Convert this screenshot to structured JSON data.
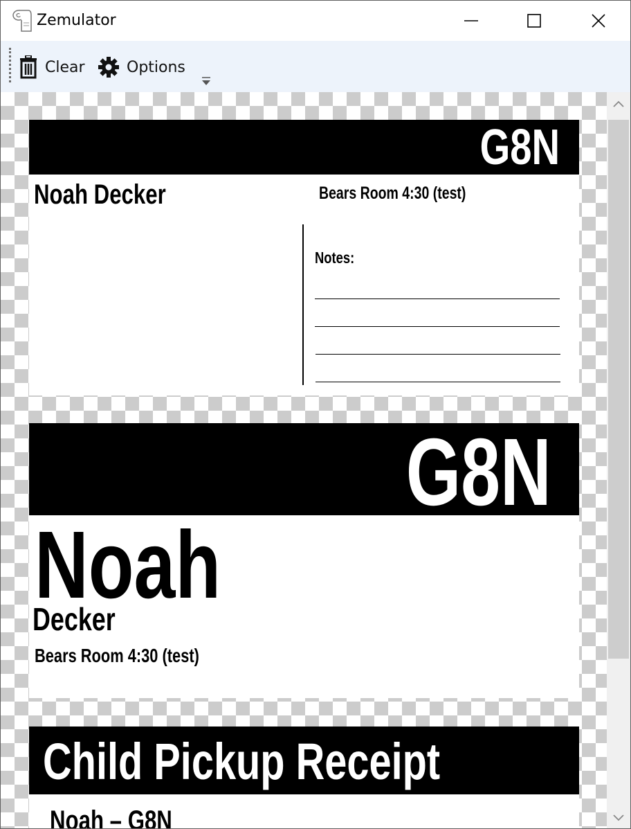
{
  "window": {
    "title": "Zemulator",
    "icon": "printer-roll-icon"
  },
  "toolbar": {
    "clear_label": "Clear",
    "options_label": "Options"
  },
  "labels": {
    "label1": {
      "code": "G8N",
      "name": "Noah Decker",
      "room": "Bears Room 4:30 (test)",
      "notes_label": "Notes:"
    },
    "label2": {
      "code": "G8N",
      "first_name": "Noah",
      "last_name": "Decker",
      "room": "Bears Room 4:30 (test)"
    },
    "label3": {
      "title": "Child Pickup Receipt",
      "subtitle": "Noah – G8N"
    }
  },
  "colors": {
    "toolbar_bg": "#edf3fb",
    "label_band": "#000000",
    "checker": "#cccccc"
  }
}
